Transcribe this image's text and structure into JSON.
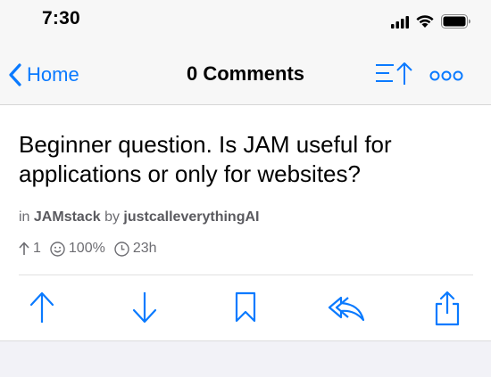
{
  "status_bar": {
    "time": "7:30"
  },
  "nav": {
    "back_label": "Home",
    "title": "0 Comments"
  },
  "post": {
    "title": "Beginner question. Is JAM useful for applications or only for websites?",
    "meta_in": "in",
    "community": "JAMstack",
    "meta_by": "by",
    "author": "justcalleverythingAI",
    "score": "1",
    "upvote_ratio": "100%",
    "age": "23h"
  },
  "actions": [
    "upvote",
    "downvote",
    "save",
    "reply",
    "share"
  ],
  "colors": {
    "accent": "#0a7aff",
    "nav_background": "#f7f7f7",
    "page_background": "#f2f2f7",
    "meta_text": "#6d6d72"
  },
  "icons": [
    "signal-icon",
    "wifi-icon",
    "battery-icon",
    "chevron-left-icon",
    "sort-icon",
    "more-icon",
    "arrow-up-icon",
    "smiley-icon",
    "clock-icon",
    "upvote-icon",
    "downvote-icon",
    "bookmark-icon",
    "reply-icon",
    "share-icon"
  ]
}
